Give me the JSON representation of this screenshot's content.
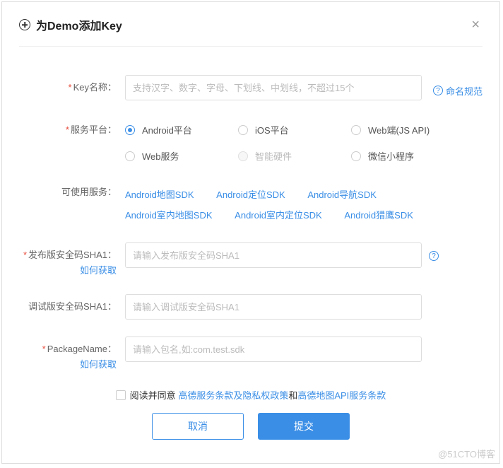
{
  "header": {
    "title": "为Demo添加Key"
  },
  "form": {
    "key_name": {
      "label": "Key名称：",
      "placeholder": "支持汉字、数字、字母、下划线、中划线，不超过15个",
      "naming_link": "命名规范"
    },
    "platform": {
      "label": "服务平台：",
      "options": [
        {
          "label": "Android平台",
          "selected": true,
          "disabled": false
        },
        {
          "label": "iOS平台",
          "selected": false,
          "disabled": false
        },
        {
          "label": "Web端(JS API)",
          "selected": false,
          "disabled": false
        },
        {
          "label": "Web服务",
          "selected": false,
          "disabled": false
        },
        {
          "label": "智能硬件",
          "selected": false,
          "disabled": true
        },
        {
          "label": "微信小程序",
          "selected": false,
          "disabled": false
        }
      ]
    },
    "services": {
      "label": "可使用服务：",
      "items": [
        "Android地图SDK",
        "Android定位SDK",
        "Android导航SDK",
        "Android室内地图SDK",
        "Android室内定位SDK",
        "Android猎鹰SDK"
      ]
    },
    "release_sha1": {
      "label": "发布版安全码SHA1：",
      "help_link": "如何获取",
      "placeholder": "请输入发布版安全码SHA1"
    },
    "debug_sha1": {
      "label": "调试版安全码SHA1：",
      "placeholder": "请输入调试版安全码SHA1"
    },
    "package_name": {
      "label": "PackageName：",
      "help_link": "如何获取",
      "placeholder": "请输入包名,如:com.test.sdk"
    }
  },
  "agreement": {
    "prefix": "阅读并同意",
    "tos_link": "高德服务条款及隐私权政策",
    "sep": " 和 ",
    "api_link": "高德地图API服务条款"
  },
  "buttons": {
    "cancel": "取消",
    "submit": "提交"
  },
  "watermark": "@51CTO博客"
}
